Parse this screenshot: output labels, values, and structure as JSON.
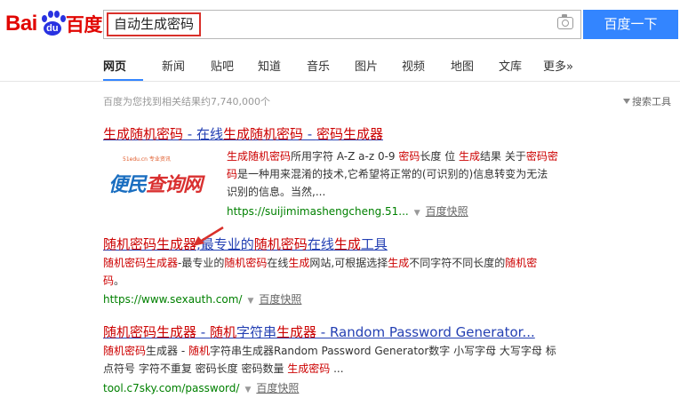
{
  "logo": {
    "text_left": "Bai",
    "text_paw": "du",
    "text_right": "百度"
  },
  "search": {
    "query": "自动生成密码",
    "button": "百度一下"
  },
  "tabs": [
    "网页",
    "新闻",
    "贴吧",
    "知道",
    "音乐",
    "图片",
    "视频",
    "地图",
    "文库",
    "更多»"
  ],
  "result_count": "百度为您找到相关结果约7,740,000个",
  "search_tools": "搜索工具",
  "results": [
    {
      "title_parts": [
        {
          "t": "生成随机密码",
          "em": true
        },
        {
          "t": " - 在线",
          "em": false
        },
        {
          "t": "生成随机密码",
          "em": true
        },
        {
          "t": " - ",
          "em": false
        },
        {
          "t": "密码生成器",
          "em": true
        }
      ],
      "snippet_lines": [
        [
          {
            "t": "生成随机密码",
            "em": true
          },
          {
            "t": "所用字符 A-Z a-z 0-9 ",
            "em": false
          },
          {
            "t": "密码",
            "em": true
          },
          {
            "t": "长度 位 ",
            "em": false
          },
          {
            "t": "生成",
            "em": true
          },
          {
            "t": "结果 关于",
            "em": false
          },
          {
            "t": "密码密",
            "em": true
          }
        ],
        [
          {
            "t": "码",
            "em": true
          },
          {
            "t": "是一种用来混淆的技术,它希望将正常的(可识别的)信息转变为无法",
            "em": false
          }
        ],
        [
          {
            "t": "识别的信息。当然,...",
            "em": false
          }
        ]
      ],
      "url": "https://suijimimashengcheng.51...",
      "snapshot": "百度快照",
      "thumb": {
        "small": "51edu.cn 专业资讯",
        "big_a": "便民",
        "big_b": "查询网"
      }
    },
    {
      "title_parts": [
        {
          "t": "随机密码生成器",
          "em": true
        },
        {
          "t": ",最专业的",
          "em": false
        },
        {
          "t": "随机密码",
          "em": true
        },
        {
          "t": "在线",
          "em": false
        },
        {
          "t": "生成",
          "em": true
        },
        {
          "t": "工具",
          "em": false
        }
      ],
      "snippet_lines": [
        [
          {
            "t": "随机密码生成器",
            "em": true
          },
          {
            "t": "-最专业的",
            "em": false
          },
          {
            "t": "随机密码",
            "em": true
          },
          {
            "t": "在线",
            "em": false
          },
          {
            "t": "生成",
            "em": true
          },
          {
            "t": "网站,可根据选择",
            "em": false
          },
          {
            "t": "生成",
            "em": true
          },
          {
            "t": "不同字符不同长度的",
            "em": false
          },
          {
            "t": "随机密",
            "em": true
          }
        ],
        [
          {
            "t": "码",
            "em": true
          },
          {
            "t": "。",
            "em": false
          }
        ]
      ],
      "url": "https://www.sexauth.com/",
      "snapshot": "百度快照"
    },
    {
      "title_parts": [
        {
          "t": "随机密码生成器",
          "em": true
        },
        {
          "t": " - ",
          "em": false
        },
        {
          "t": "随机",
          "em": true
        },
        {
          "t": "字符串",
          "em": false
        },
        {
          "t": "生成器",
          "em": true
        },
        {
          "t": " - Random Password Generator...",
          "em": false
        }
      ],
      "snippet_lines": [
        [
          {
            "t": "随机密码",
            "em": true
          },
          {
            "t": "生成器 - ",
            "em": false
          },
          {
            "t": "随机",
            "em": true
          },
          {
            "t": "字符串生成器Random Password Generator数字 小写字母 大写字母 标",
            "em": false
          }
        ],
        [
          {
            "t": "点符号 字符不重复 密码长度 密码数量 ",
            "em": false
          },
          {
            "t": "生成密码",
            "em": true
          },
          {
            "t": " ...",
            "em": false
          }
        ]
      ],
      "url": "tool.c7sky.com/password/",
      "snapshot": "百度快照"
    }
  ],
  "colors": {
    "brand_red": "#e10602",
    "brand_blue": "#2932e1",
    "button": "#3385ff",
    "link": "#2440b3",
    "highlight": "#cc0000",
    "url": "#008000",
    "annotation": "#d9302a"
  }
}
